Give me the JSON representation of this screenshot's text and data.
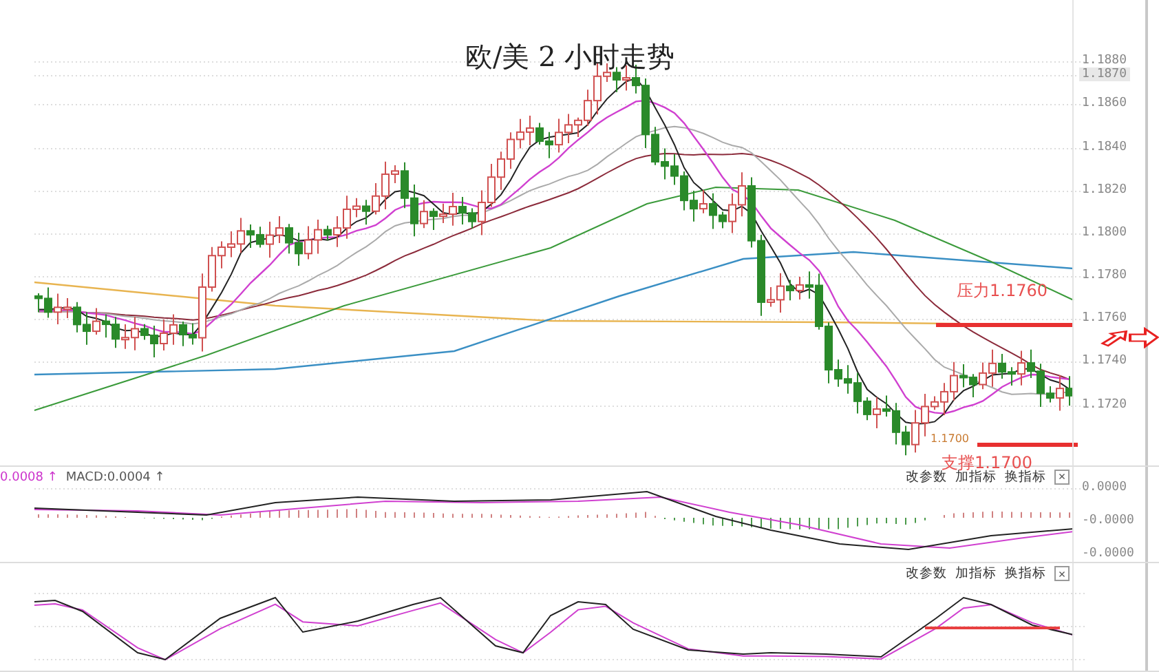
{
  "chart": {
    "title": "欧/美 2 小时走势",
    "price_axis": [
      {
        "label": "1.1880",
        "highlighted": false
      },
      {
        "label": "1.1870",
        "highlighted": true
      },
      {
        "label": "1.1860",
        "highlighted": false
      },
      {
        "label": "1.1840",
        "highlighted": false
      },
      {
        "label": "1.1820",
        "highlighted": false
      },
      {
        "label": "1.1800",
        "highlighted": false
      },
      {
        "label": "1.1780",
        "highlighted": false
      },
      {
        "label": "1.1760",
        "highlighted": false
      },
      {
        "label": "1.1740",
        "highlighted": false
      },
      {
        "label": "1.1720",
        "highlighted": false
      }
    ],
    "annotations": [
      {
        "kind": "resistance",
        "text": "压力1.1760"
      },
      {
        "kind": "support",
        "text": "支撑1.1700"
      },
      {
        "kind": "low_marker",
        "text": "1.1700"
      }
    ]
  },
  "macd_panel": {
    "readings": [
      {
        "text": "0.0008",
        "arrow": "↑",
        "color": "#cc33cc"
      },
      {
        "text": "MACD:0.0004",
        "arrow": "↑",
        "color": "#555555"
      }
    ],
    "buttons": [
      "改参数",
      "加指标",
      "换指标"
    ],
    "close": "×",
    "axis": [
      "0.0000",
      "-0.0000",
      "-0.0000"
    ]
  },
  "kd_panel": {
    "buttons": [
      "改参数",
      "加指标",
      "换指标"
    ],
    "close": "×"
  }
}
